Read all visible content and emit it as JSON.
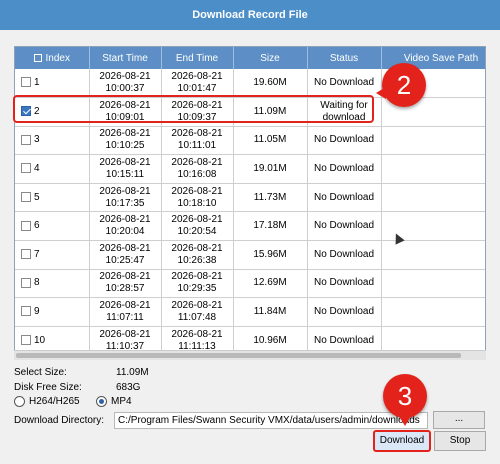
{
  "window": {
    "title": "Download Record File"
  },
  "table": {
    "columns": [
      "Index",
      "Start Time",
      "End Time",
      "Size",
      "Status",
      "Video Save Path"
    ],
    "rows": [
      {
        "index": "1",
        "checked": false,
        "start_date": "2026-08-21",
        "start_time": "10:00:37",
        "end_date": "2026-08-21",
        "end_time": "10:01:47",
        "size": "19.60M",
        "status": "No Download",
        "path": ""
      },
      {
        "index": "2",
        "checked": true,
        "start_date": "2026-08-21",
        "start_time": "10:09:01",
        "end_date": "2026-08-21",
        "end_time": "10:09:37",
        "size": "11.09M",
        "status": "Waiting for download",
        "path": ""
      },
      {
        "index": "3",
        "checked": false,
        "start_date": "2026-08-21",
        "start_time": "10:10:25",
        "end_date": "2026-08-21",
        "end_time": "10:11:01",
        "size": "11.05M",
        "status": "No Download",
        "path": ""
      },
      {
        "index": "4",
        "checked": false,
        "start_date": "2026-08-21",
        "start_time": "10:15:11",
        "end_date": "2026-08-21",
        "end_time": "10:16:08",
        "size": "19.01M",
        "status": "No Download",
        "path": ""
      },
      {
        "index": "5",
        "checked": false,
        "start_date": "2026-08-21",
        "start_time": "10:17:35",
        "end_date": "2026-08-21",
        "end_time": "10:18:10",
        "size": "11.73M",
        "status": "No Download",
        "path": ""
      },
      {
        "index": "6",
        "checked": false,
        "start_date": "2026-08-21",
        "start_time": "10:20:04",
        "end_date": "2026-08-21",
        "end_time": "10:20:54",
        "size": "17.18M",
        "status": "No Download",
        "path": ""
      },
      {
        "index": "7",
        "checked": false,
        "start_date": "2026-08-21",
        "start_time": "10:25:47",
        "end_date": "2026-08-21",
        "end_time": "10:26:38",
        "size": "15.96M",
        "status": "No Download",
        "path": ""
      },
      {
        "index": "8",
        "checked": false,
        "start_date": "2026-08-21",
        "start_time": "10:28:57",
        "end_date": "2026-08-21",
        "end_time": "10:29:35",
        "size": "12.69M",
        "status": "No Download",
        "path": ""
      },
      {
        "index": "9",
        "checked": false,
        "start_date": "2026-08-21",
        "start_time": "11:07:11",
        "end_date": "2026-08-21",
        "end_time": "11:07:48",
        "size": "11.84M",
        "status": "No Download",
        "path": ""
      },
      {
        "index": "10",
        "checked": false,
        "start_date": "2026-08-21",
        "start_time": "11:10:37",
        "end_date": "2026-08-21",
        "end_time": "11:11:13",
        "size": "10.96M",
        "status": "No Download",
        "path": ""
      }
    ]
  },
  "summary": {
    "select_size_label": "Select Size:",
    "select_size_value": "11.09M",
    "disk_free_label": "Disk Free Size:",
    "disk_free_value": "683G"
  },
  "format": {
    "options": [
      {
        "label": "H264/H265",
        "selected": false
      },
      {
        "label": "MP4",
        "selected": true
      }
    ]
  },
  "directory": {
    "label": "Download Directory:",
    "value": "C:/Program Files/Swann Security VMX/data/users/admin/downloads",
    "browse_label": "..."
  },
  "buttons": {
    "download": "Download",
    "stop": "Stop"
  },
  "annotations": {
    "step_2": "2",
    "step_3": "3",
    "color": "#e3231b"
  }
}
